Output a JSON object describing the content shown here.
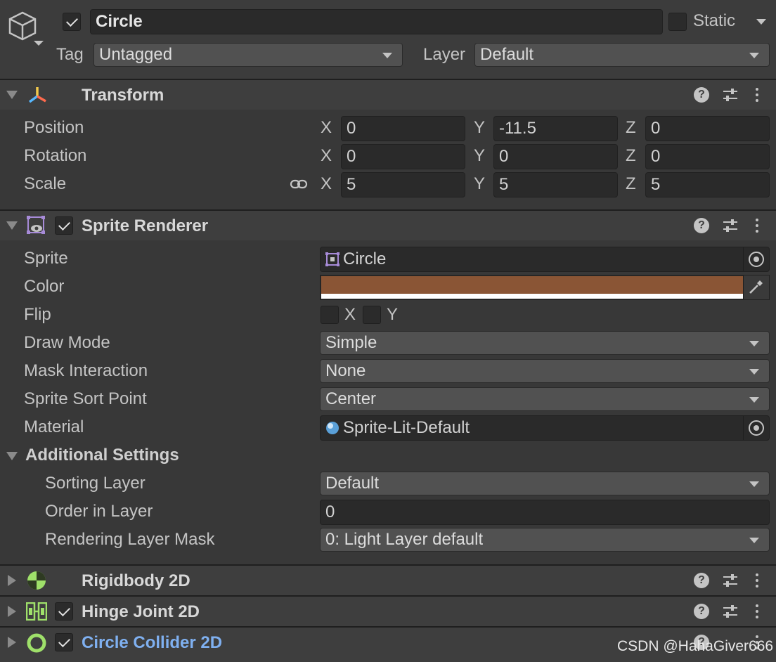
{
  "header": {
    "object_name": "Circle",
    "static_label": "Static",
    "tag_label": "Tag",
    "tag_value": "Untagged",
    "layer_label": "Layer",
    "layer_value": "Default"
  },
  "transform": {
    "title": "Transform",
    "rows": [
      {
        "label": "Position",
        "x": "0",
        "y": "-11.5",
        "z": "0"
      },
      {
        "label": "Rotation",
        "x": "0",
        "y": "0",
        "z": "0"
      },
      {
        "label": "Scale",
        "x": "5",
        "y": "5",
        "z": "5"
      }
    ],
    "axis_x": "X",
    "axis_y": "Y",
    "axis_z": "Z"
  },
  "sprite_renderer": {
    "title": "Sprite Renderer",
    "sprite_label": "Sprite",
    "sprite_value": "Circle",
    "color_label": "Color",
    "color_value": "#8a5535",
    "flip_label": "Flip",
    "flip_x": "X",
    "flip_y": "Y",
    "draw_mode_label": "Draw Mode",
    "draw_mode_value": "Simple",
    "mask_label": "Mask Interaction",
    "mask_value": "None",
    "sort_point_label": "Sprite Sort Point",
    "sort_point_value": "Center",
    "material_label": "Material",
    "material_value": "Sprite-Lit-Default",
    "additional_settings": "Additional Settings",
    "sorting_layer_label": "Sorting Layer",
    "sorting_layer_value": "Default",
    "order_label": "Order in Layer",
    "order_value": "0",
    "rendering_mask_label": "Rendering Layer Mask",
    "rendering_mask_value": "0: Light Layer default"
  },
  "components": {
    "rigidbody": "Rigidbody 2D",
    "hinge": "Hinge Joint 2D",
    "collider": "Circle Collider 2D"
  },
  "watermark": "CSDN @HahaGiver666",
  "colors": {
    "accent_link": "#7fb0f0",
    "panel": "#383838",
    "header": "#3e3e3e"
  }
}
